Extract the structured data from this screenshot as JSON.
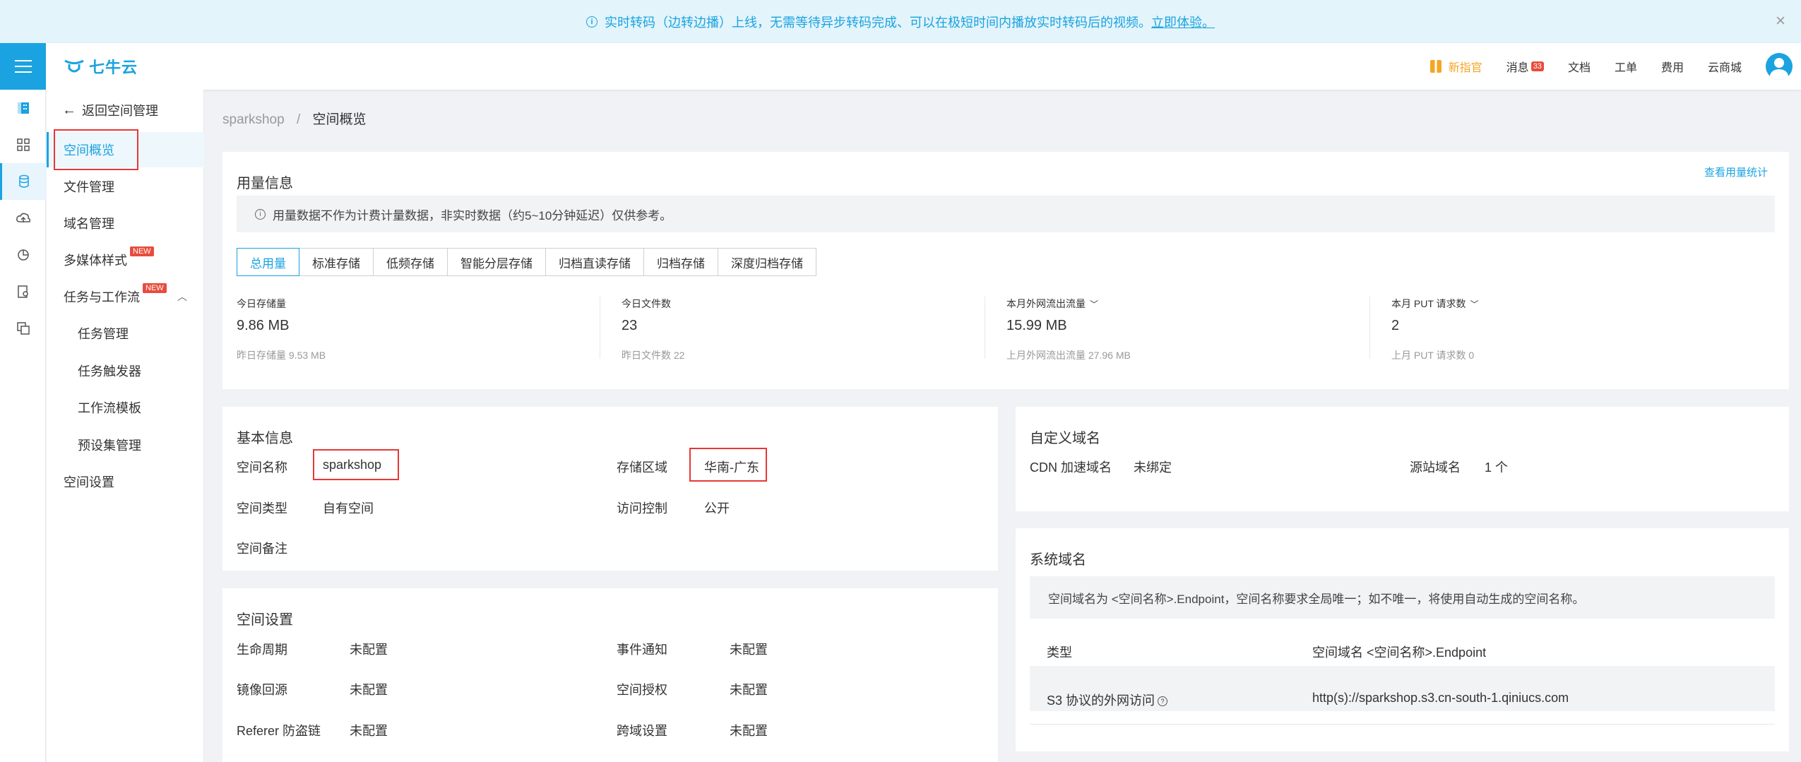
{
  "banner": {
    "text": "实时转码（边转边播）上线，无需等待异步转码完成、可以在极短时间内播放实时转码后的视频。",
    "link": "立即体验。"
  },
  "header": {
    "logo_text": "七牛云",
    "items": {
      "new_guide": "新指官",
      "messages": "消息",
      "messages_badge": "33",
      "docs": "文档",
      "tickets": "工单",
      "billing": "费用",
      "mall": "云商城"
    }
  },
  "sidenav": {
    "back": "返回空间管理",
    "items": [
      {
        "label": "空间概览"
      },
      {
        "label": "文件管理"
      },
      {
        "label": "域名管理"
      },
      {
        "label": "多媒体样式",
        "tag": "NEW"
      },
      {
        "label": "任务与工作流",
        "tag": "NEW"
      },
      {
        "label": "任务管理"
      },
      {
        "label": "任务触发器"
      },
      {
        "label": "工作流模板"
      },
      {
        "label": "预设集管理"
      },
      {
        "label": "空间设置"
      }
    ]
  },
  "breadcrumb": {
    "root": "sparkshop",
    "sep": "/",
    "current": "空间概览"
  },
  "usage": {
    "title": "用量信息",
    "view_stats": "查看用量统计",
    "note": "用量数据不作为计费计量数据，非实时数据（约5~10分钟延迟）仅供参考。",
    "tabs": [
      "总用量",
      "标准存储",
      "低频存储",
      "智能分层存储",
      "归档直读存储",
      "归档存储",
      "深度归档存储"
    ],
    "stats": [
      {
        "label": "今日存储量",
        "value": "9.86 MB",
        "prev": "昨日存储量 9.53 MB"
      },
      {
        "label": "今日文件数",
        "value": "23",
        "prev": "昨日文件数 22"
      },
      {
        "label": "本月外网流出流量",
        "value": "15.99 MB",
        "prev": "上月外网流出流量 27.96 MB"
      },
      {
        "label": "本月 PUT 请求数",
        "value": "2",
        "prev": "上月 PUT 请求数 0"
      }
    ]
  },
  "basic": {
    "title": "基本信息",
    "name_k": "空间名称",
    "name_v": "sparkshop",
    "region_k": "存储区域",
    "region_v": "华南-广东",
    "type_k": "空间类型",
    "type_v": "自有空间",
    "acl_k": "访问控制",
    "acl_v": "公开",
    "remark_k": "空间备注"
  },
  "settings": {
    "title": "空间设置",
    "rows": [
      {
        "k1": "生命周期",
        "v1": "未配置",
        "k2": "事件通知",
        "v2": "未配置"
      },
      {
        "k1": "镜像回源",
        "v1": "未配置",
        "k2": "空间授权",
        "v2": "未配置"
      },
      {
        "k1": "Referer 防盗链",
        "v1": "未配置",
        "k2": "跨域设置",
        "v2": "未配置"
      }
    ]
  },
  "custom_domain": {
    "title": "自定义域名",
    "cdn_k": "CDN 加速域名",
    "cdn_v": "未绑定",
    "origin_k": "源站域名",
    "origin_v": "1 个"
  },
  "system_domain": {
    "title": "系统域名",
    "note": "空间域名为 <空间名称>.Endpoint，空间名称要求全局唯一；如不唯一，将使用自动生成的空间名称。",
    "col1": "类型",
    "col2": "空间域名 <空间名称>.Endpoint",
    "row_k": "S3 协议的外网访问",
    "row_v": "http(s)://sparkshop.s3.cn-south-1.qiniucs.com"
  }
}
